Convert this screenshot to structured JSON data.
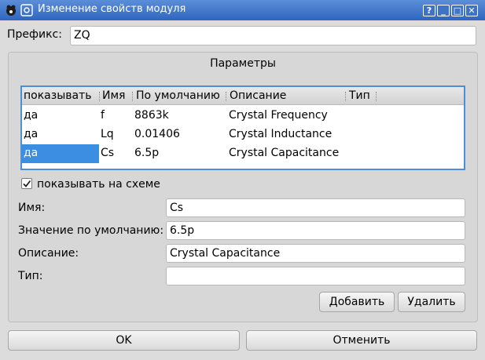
{
  "window": {
    "title": "Изменение свойств модуля",
    "help_label": "?",
    "minimize_label": "_",
    "maximize_label": "□",
    "close_label": "✕"
  },
  "prefix": {
    "label": "Префикс:",
    "value": "ZQ"
  },
  "params": {
    "title": "Параметры",
    "columns": [
      "показывать",
      "Имя",
      "По умолчанию",
      "Описание",
      "Тип"
    ],
    "rows": [
      {
        "show": "да",
        "name": "f",
        "default": "8863k",
        "description": "Crystal Frequency",
        "type": ""
      },
      {
        "show": "да",
        "name": "Lq",
        "default": "0.01406",
        "description": "Crystal Inductance",
        "type": ""
      },
      {
        "show": "да",
        "name": "Cs",
        "default": "6.5p",
        "description": "Crystal Capacitance",
        "type": ""
      }
    ],
    "selected_row": 2
  },
  "show_on_schematic": {
    "label": "показывать на схеме",
    "checked": true
  },
  "form": {
    "name_label": "Имя:",
    "name_value": "Cs",
    "default_label": "Значение по умолчанию:",
    "default_value": "6.5p",
    "description_label": "Описание:",
    "description_value": "Crystal Capacitance",
    "type_label": "Тип:",
    "type_value": ""
  },
  "buttons": {
    "add": "Добавить",
    "remove": "Удалить",
    "ok": "OK",
    "cancel": "Отменить"
  },
  "colors": {
    "titlebar": "#3a72c8",
    "selection": "#3c8ee2",
    "table_border": "#4a90d9"
  }
}
